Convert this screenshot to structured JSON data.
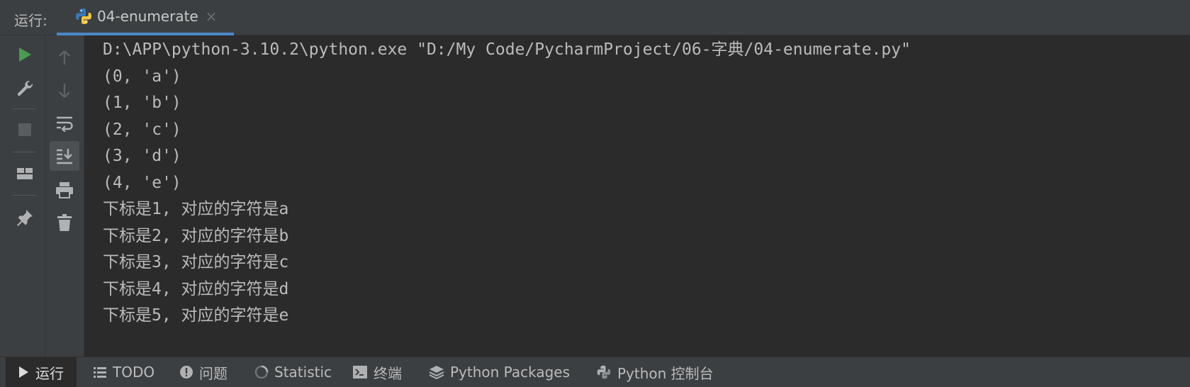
{
  "header": {
    "run_label": "运行:",
    "tab_title": "04-enumerate",
    "tab_close": "×"
  },
  "left_toolbar": {
    "icons": [
      "run-icon",
      "wrench-icon",
      "stop-icon",
      "layout-icon",
      "pin-icon"
    ]
  },
  "secondary_toolbar": {
    "icons": [
      "arrow-up-icon",
      "arrow-down-icon",
      "soft-wrap-icon",
      "scroll-to-end-icon",
      "print-icon",
      "trash-icon"
    ]
  },
  "console": {
    "lines": [
      "D:\\APP\\python-3.10.2\\python.exe \"D:/My Code/PycharmProject/06-字典/04-enumerate.py\"",
      "(0, 'a')",
      "(1, 'b')",
      "(2, 'c')",
      "(3, 'd')",
      "(4, 'e')",
      "下标是1, 对应的字符是a",
      "下标是2, 对应的字符是b",
      "下标是3, 对应的字符是c",
      "下标是4, 对应的字符是d",
      "下标是5, 对应的字符是e"
    ]
  },
  "bottom_tabs": [
    {
      "label": "运行",
      "icon": "play-icon",
      "active": true
    },
    {
      "label": "TODO",
      "icon": "list-icon"
    },
    {
      "label": "问题",
      "icon": "info-icon"
    },
    {
      "label": "Statistic",
      "icon": "statistic-icon"
    },
    {
      "label": "终端",
      "icon": "terminal-icon"
    },
    {
      "label": "Python Packages",
      "icon": "layers-icon"
    },
    {
      "label": "Python 控制台",
      "icon": "python-console-icon"
    }
  ],
  "colors": {
    "background": "#2b2b2b",
    "panel": "#3c3f41",
    "accent": "#4a88c7",
    "run_green": "#499c54",
    "text": "#bbbbbb"
  }
}
